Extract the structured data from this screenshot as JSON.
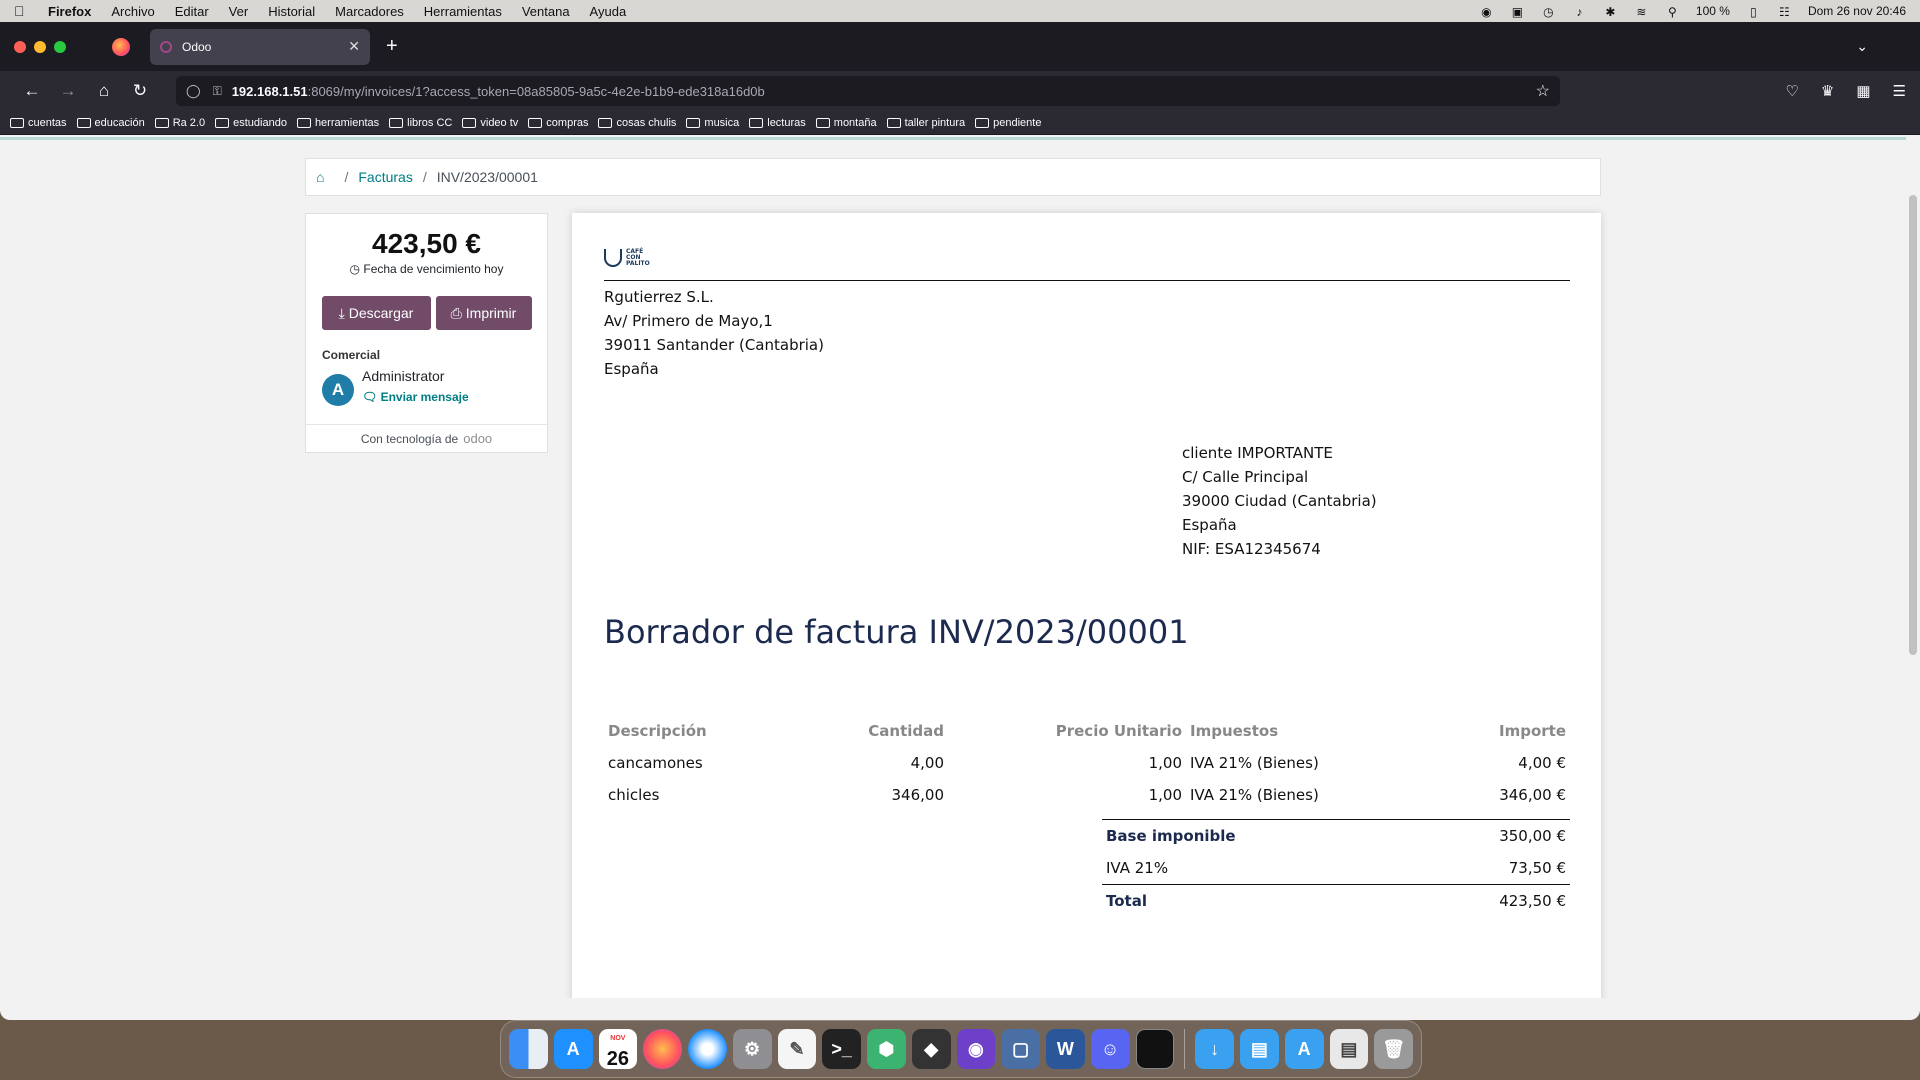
{
  "menubar": {
    "app": "Firefox",
    "items": [
      "Archivo",
      "Editar",
      "Ver",
      "Historial",
      "Marcadores",
      "Herramientas",
      "Ventana",
      "Ayuda"
    ],
    "battery": "100 %",
    "datetime": "Dom 26 nov  20:46"
  },
  "browser": {
    "tab_title": "Odoo",
    "url_host": "192.168.1.51",
    "url_path": ":8069/my/invoices/1?access_token=08a85805-9a5c-4e2e-b1b9-ede318a16d0b",
    "bookmarks": [
      "cuentas",
      "educación",
      "Ra 2.0",
      "estudiando",
      "herramientas",
      "libros CC",
      "video tv",
      "compras",
      "cosas chulis",
      "musica",
      "lecturas",
      "montaña",
      "taller pintura",
      "pendiente"
    ]
  },
  "breadcrumb": {
    "link": "Facturas",
    "current": "INV/2023/00001"
  },
  "sidebar": {
    "amount": "423,50 €",
    "due": "Fecha de vencimiento hoy",
    "download_label": "Descargar",
    "print_label": "Imprimir",
    "salesperson_label": "Comercial",
    "avatar_letter": "A",
    "salesperson_name": "Administrator",
    "send_message": "Enviar mensaje",
    "powered_by": "Con tecnología de",
    "powered_brand": "odoo"
  },
  "invoice": {
    "logo_text": [
      "CAFÉ",
      "CON",
      "PALITO"
    ],
    "company": [
      "Rgutierrez S.L.",
      "Av/ Primero de Mayo,1",
      "39011 Santander (Cantabria)",
      "España"
    ],
    "client": [
      "cliente IMPORTANTE",
      "C/ Calle Principal",
      "39000 Ciudad (Cantabria)",
      "España",
      "NIF: ESA12345674"
    ],
    "title": "Borrador de factura INV/2023/00001",
    "headers": [
      "Descripción",
      "Cantidad",
      "Precio Unitario",
      "Impuestos",
      "Importe"
    ],
    "lines": [
      [
        "cancamones",
        "4,00",
        "1,00",
        "IVA 21% (Bienes)",
        "4,00 €"
      ],
      [
        "chicles",
        "346,00",
        "1,00",
        "IVA 21% (Bienes)",
        "346,00 €"
      ]
    ],
    "totals": {
      "base_label": "Base imponible",
      "base_value": "350,00 €",
      "tax_label": "IVA 21%",
      "tax_value": "73,50 €",
      "total_label": "Total",
      "total_value": "423,50 €"
    }
  },
  "dock": {
    "calendar_month": "NOV",
    "calendar_day": "26"
  },
  "colors": {
    "accent": "#714b67",
    "link": "#017e84",
    "title": "#1b2a4e"
  }
}
